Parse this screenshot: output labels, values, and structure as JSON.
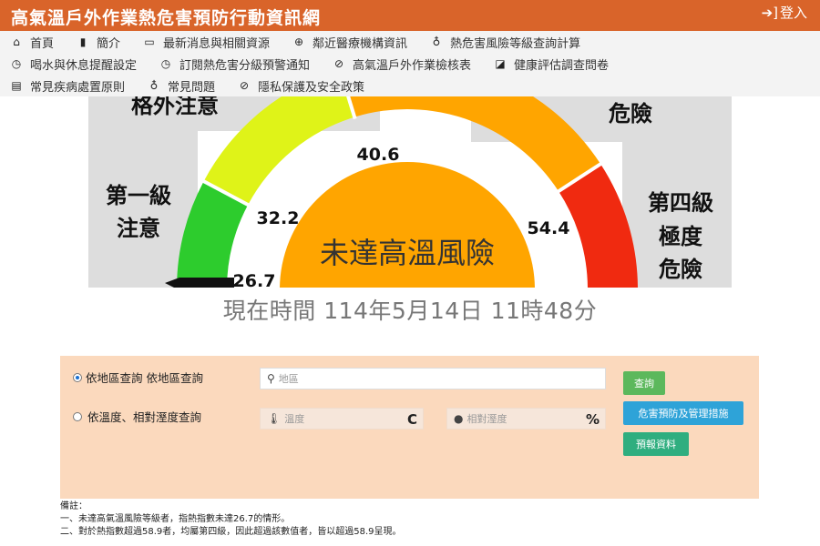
{
  "header": {
    "title": "高氣溫戶外作業熱危害預防行動資訊網",
    "login_label": "登入"
  },
  "nav": {
    "row1": [
      {
        "label": "首頁",
        "icon": "home-icon"
      },
      {
        "label": "簡介",
        "icon": "bookmark-icon"
      },
      {
        "label": "最新消息與相關資源",
        "icon": "folder-icon"
      },
      {
        "label": "鄰近醫療機構資訊",
        "icon": "plus-circle-icon"
      },
      {
        "label": "熱危害風險等級查詢計算",
        "icon": "lightbulb-icon"
      }
    ],
    "row2": [
      {
        "label": "喝水與休息提醒設定",
        "icon": "clock-icon"
      },
      {
        "label": "訂閱熱危害分級預警通知",
        "icon": "clock-icon"
      },
      {
        "label": "高氣溫戶外作業檢核表",
        "icon": "check-circle-icon"
      },
      {
        "label": "健康評估調查問卷",
        "icon": "edit-square-icon"
      }
    ],
    "row3": [
      {
        "label": "常見疾病處置原則",
        "icon": "clipboard-icon"
      },
      {
        "label": "常見問題",
        "icon": "lightbulb-icon"
      },
      {
        "label": "隱私保護及安全政策",
        "icon": "check-circle-icon"
      }
    ]
  },
  "gauge": {
    "center_label": "未達高溫風險",
    "thresholds": [
      "26.7",
      "32.2",
      "40.6",
      "54.4"
    ],
    "level_labels": {
      "level1_line1": "第一級",
      "level1_line2": "注意",
      "level2_partial": "格外注意",
      "level3_partial": "危險",
      "level4_line1": "第四級",
      "level4_line2": "極度",
      "level4_line3": "危險"
    },
    "colors": {
      "green": "#2dcc2d",
      "yellowgreen": "#dff318",
      "orange": "#ffa500",
      "red": "#f02a10"
    }
  },
  "current_time": "現在時間 114年5月14日 11時48分",
  "query": {
    "option1_label": "依地區查詢 依地區查詢",
    "option2_label": "依溫度、相對溼度查詢",
    "area_placeholder": "地區",
    "temp_placeholder": "溫度",
    "temp_unit": "C",
    "humidity_placeholder": "相對溼度",
    "humidity_unit": "%",
    "search_button": "查詢",
    "prevention_button": "危害預防及管理措施",
    "report_button": "預報資料"
  },
  "notes": {
    "heading": "備註：",
    "line1": "一、未達高氣溫風險等級者，指熱指數未達26.7的情形。",
    "line2": "二、對於熱指數超過58.9者，均屬第四級，因此超過該數值者，皆以超過58.9呈現。"
  }
}
